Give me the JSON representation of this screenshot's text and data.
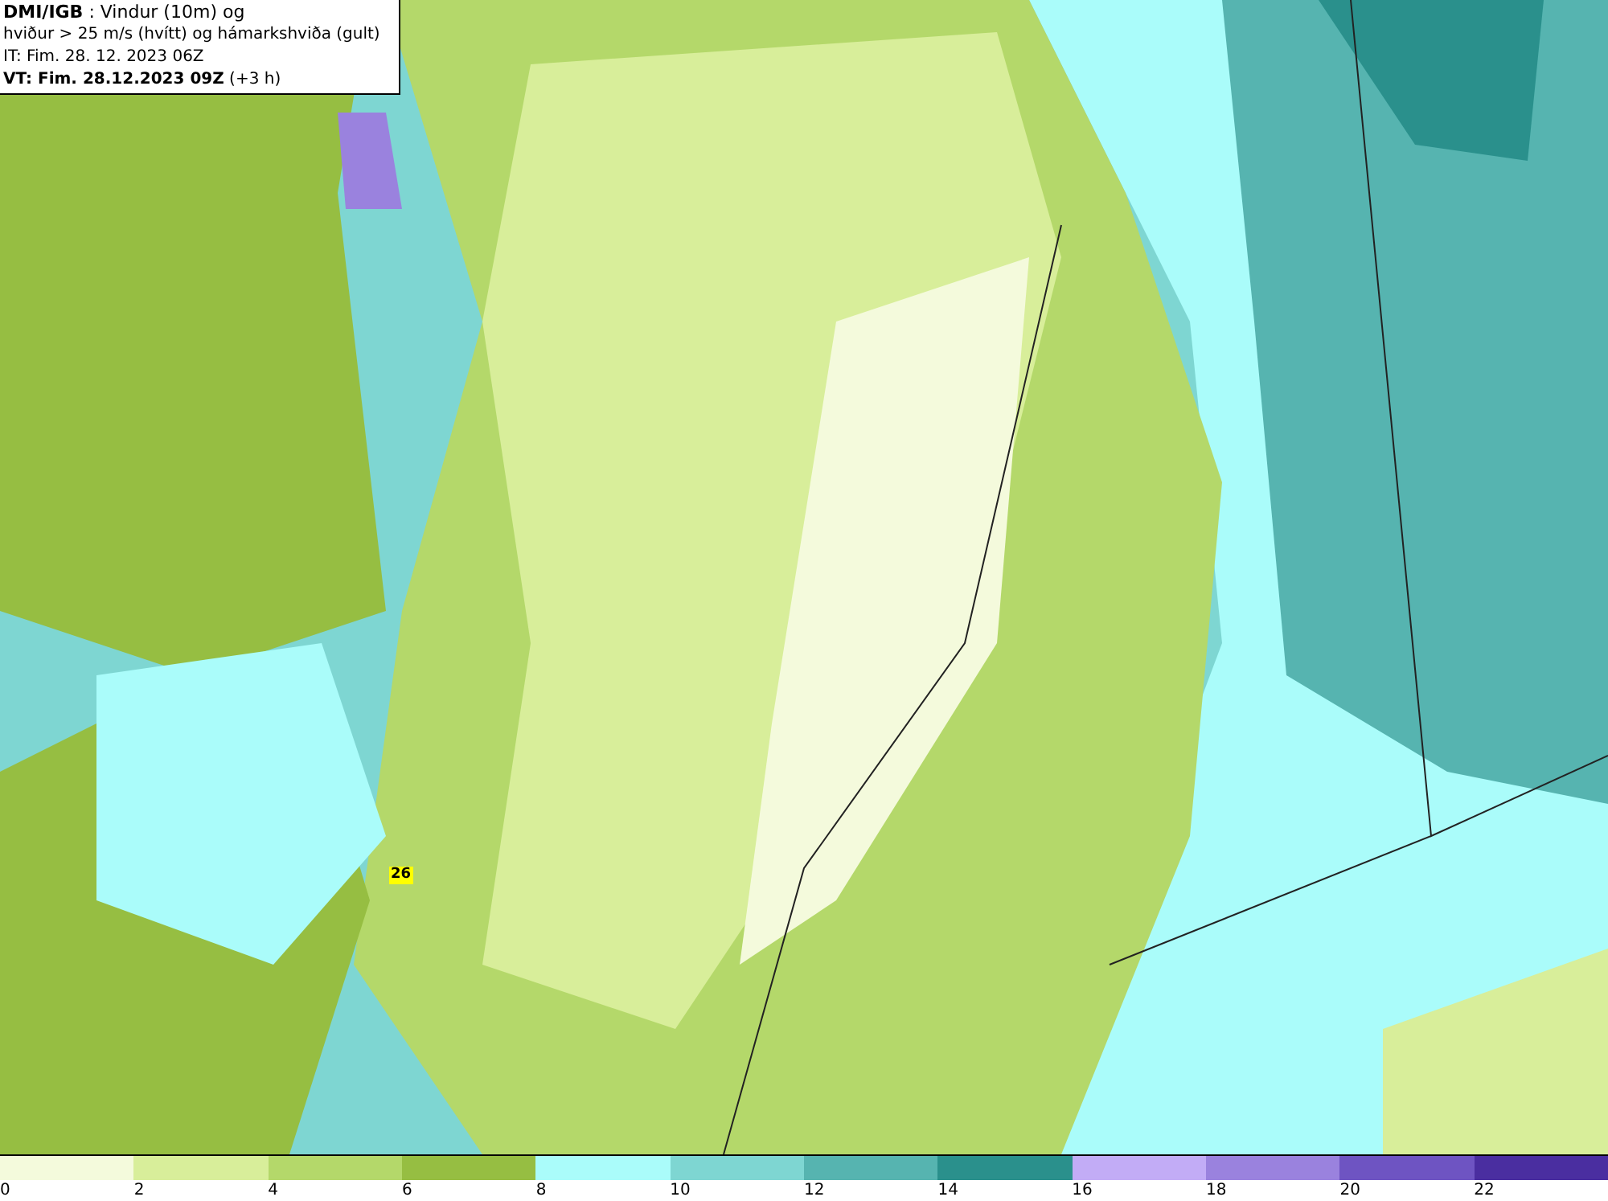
{
  "title_box": {
    "lines": [
      "**DMI/IGB** : Vindur (10m) og",
      "hviður > 25 m/s (hvítt) og hámarkshviða (gult)",
      "IT: Fim. 28. 12. 2023 06Z",
      "**VT: Fim. 28.12.2023 09Z** (+3 h)"
    ]
  },
  "map": {
    "gust_label": "26"
  },
  "legend": [
    {
      "label": "0",
      "color": "#f4fadc"
    },
    {
      "label": "2",
      "color": "#d8ee9a"
    },
    {
      "label": "4",
      "color": "#b4d86a"
    },
    {
      "label": "6",
      "color": "#96be42"
    },
    {
      "label": "8",
      "color": "#aafcfa"
    },
    {
      "label": "10",
      "color": "#7ed6d2"
    },
    {
      "label": "12",
      "color": "#56b4b0"
    },
    {
      "label": "14",
      "color": "#2a908c"
    },
    {
      "label": "16",
      "color": "#c2acf6"
    },
    {
      "label": "18",
      "color": "#9a82de"
    },
    {
      "label": "20",
      "color": "#6e54c2"
    },
    {
      "label": "22",
      "color": "#4a2ea0"
    }
  ]
}
